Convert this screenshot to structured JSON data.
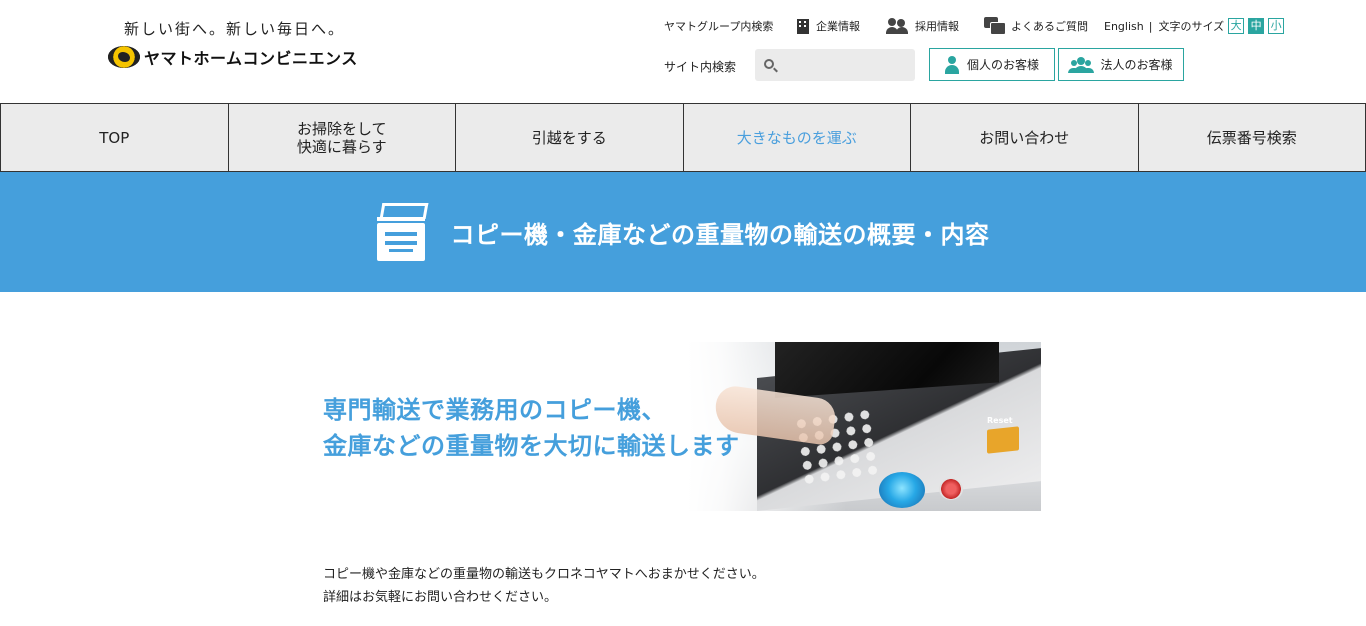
{
  "header": {
    "tagline": "新しい街へ。新しい毎日へ。",
    "logo_text": "ヤマトホームコンビニエンス"
  },
  "util": {
    "group_search": "ヤマトグループ内検索",
    "company_info": "企業情報",
    "recruit_info": "採用情報",
    "faq": "よくあるご質問",
    "english": "English",
    "sep": "|",
    "font_size_label": "文字のサイズ",
    "font_size_large": "大",
    "font_size_medium": "中",
    "font_size_small": "小"
  },
  "search": {
    "label": "サイト内検索",
    "placeholder": "",
    "value": ""
  },
  "customer_buttons": {
    "personal": "個人のお客様",
    "corporate": "法人のお客様"
  },
  "nav": {
    "items": [
      {
        "label": "TOP"
      },
      {
        "label": "お掃除をして\n快適に暮らす"
      },
      {
        "label": "引越をする"
      },
      {
        "label": "大きなものを運ぶ"
      },
      {
        "label": "お問い合わせ"
      },
      {
        "label": "伝票番号検索"
      }
    ]
  },
  "banner": {
    "title": "コピー機・金庫などの重量物の輸送の概要・内容"
  },
  "hero": {
    "line1": "専門輸送で業務用のコピー機、",
    "line2": "金庫などの重量物を大切に輸送します",
    "reset_label": "Reset"
  },
  "body": {
    "line1": "コピー機や金庫などの重量物の輸送もクロネコヤマトへおまかせください。",
    "line2": "詳細はお気軽にお問い合わせください。"
  },
  "colors": {
    "accent": "#2aa5a0",
    "banner_blue": "#459fdc",
    "nav_active": "#4a9fdd"
  }
}
